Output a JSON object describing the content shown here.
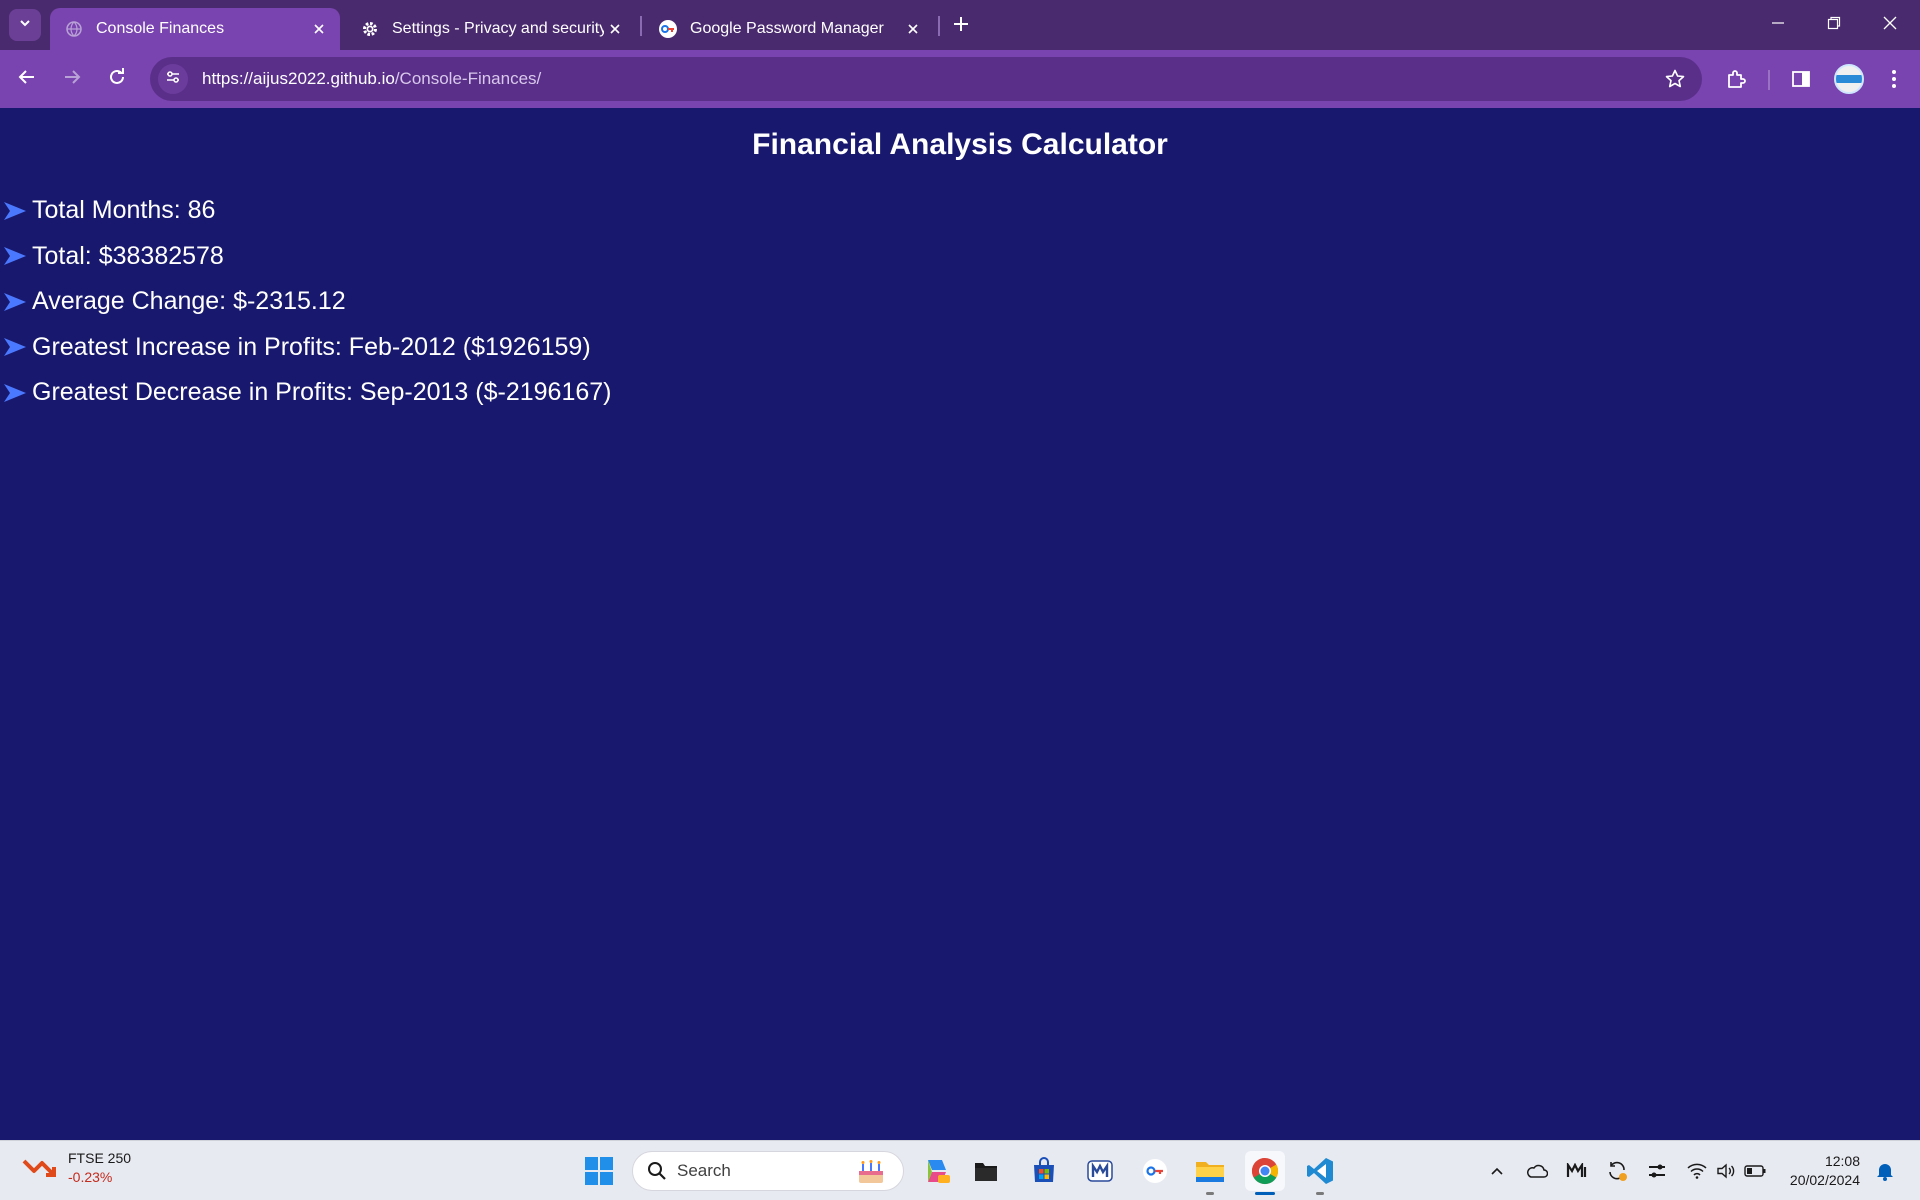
{
  "browser": {
    "tabs": [
      {
        "title": "Console Finances",
        "active": true
      },
      {
        "title": "Settings - Privacy and security",
        "active": false
      },
      {
        "title": "Google Password Manager",
        "active": false
      }
    ],
    "url": {
      "host": "https://aijus2022.github.io",
      "path": "/Console-Finances/"
    }
  },
  "page": {
    "title": "Financial Analysis Calculator",
    "items": [
      {
        "label": "Total Months: 86"
      },
      {
        "label": "Total: $38382578"
      },
      {
        "label": "Average Change: $-2315.12"
      },
      {
        "label": "Greatest Increase in Profits: Feb-2012 ($1926159)"
      },
      {
        "label": "Greatest Decrease in Profits: Sep-2013 ($-2196167)"
      }
    ],
    "colors": {
      "background": "#18186e",
      "text": "#ffffff",
      "bullet": "#4a78ff"
    }
  },
  "taskbar": {
    "widget": {
      "name": "FTSE 250",
      "change": "-0.23%"
    },
    "search_placeholder": "Search",
    "clock": {
      "time": "12:08",
      "date": "20/02/2024"
    },
    "apps": [
      "start-icon",
      "search-icon",
      "copilot-icon",
      "file-manager-icon",
      "microsoft-store-icon",
      "mail-icon",
      "password-manager-icon",
      "file-explorer-icon",
      "chrome-icon",
      "vscode-icon"
    ]
  }
}
